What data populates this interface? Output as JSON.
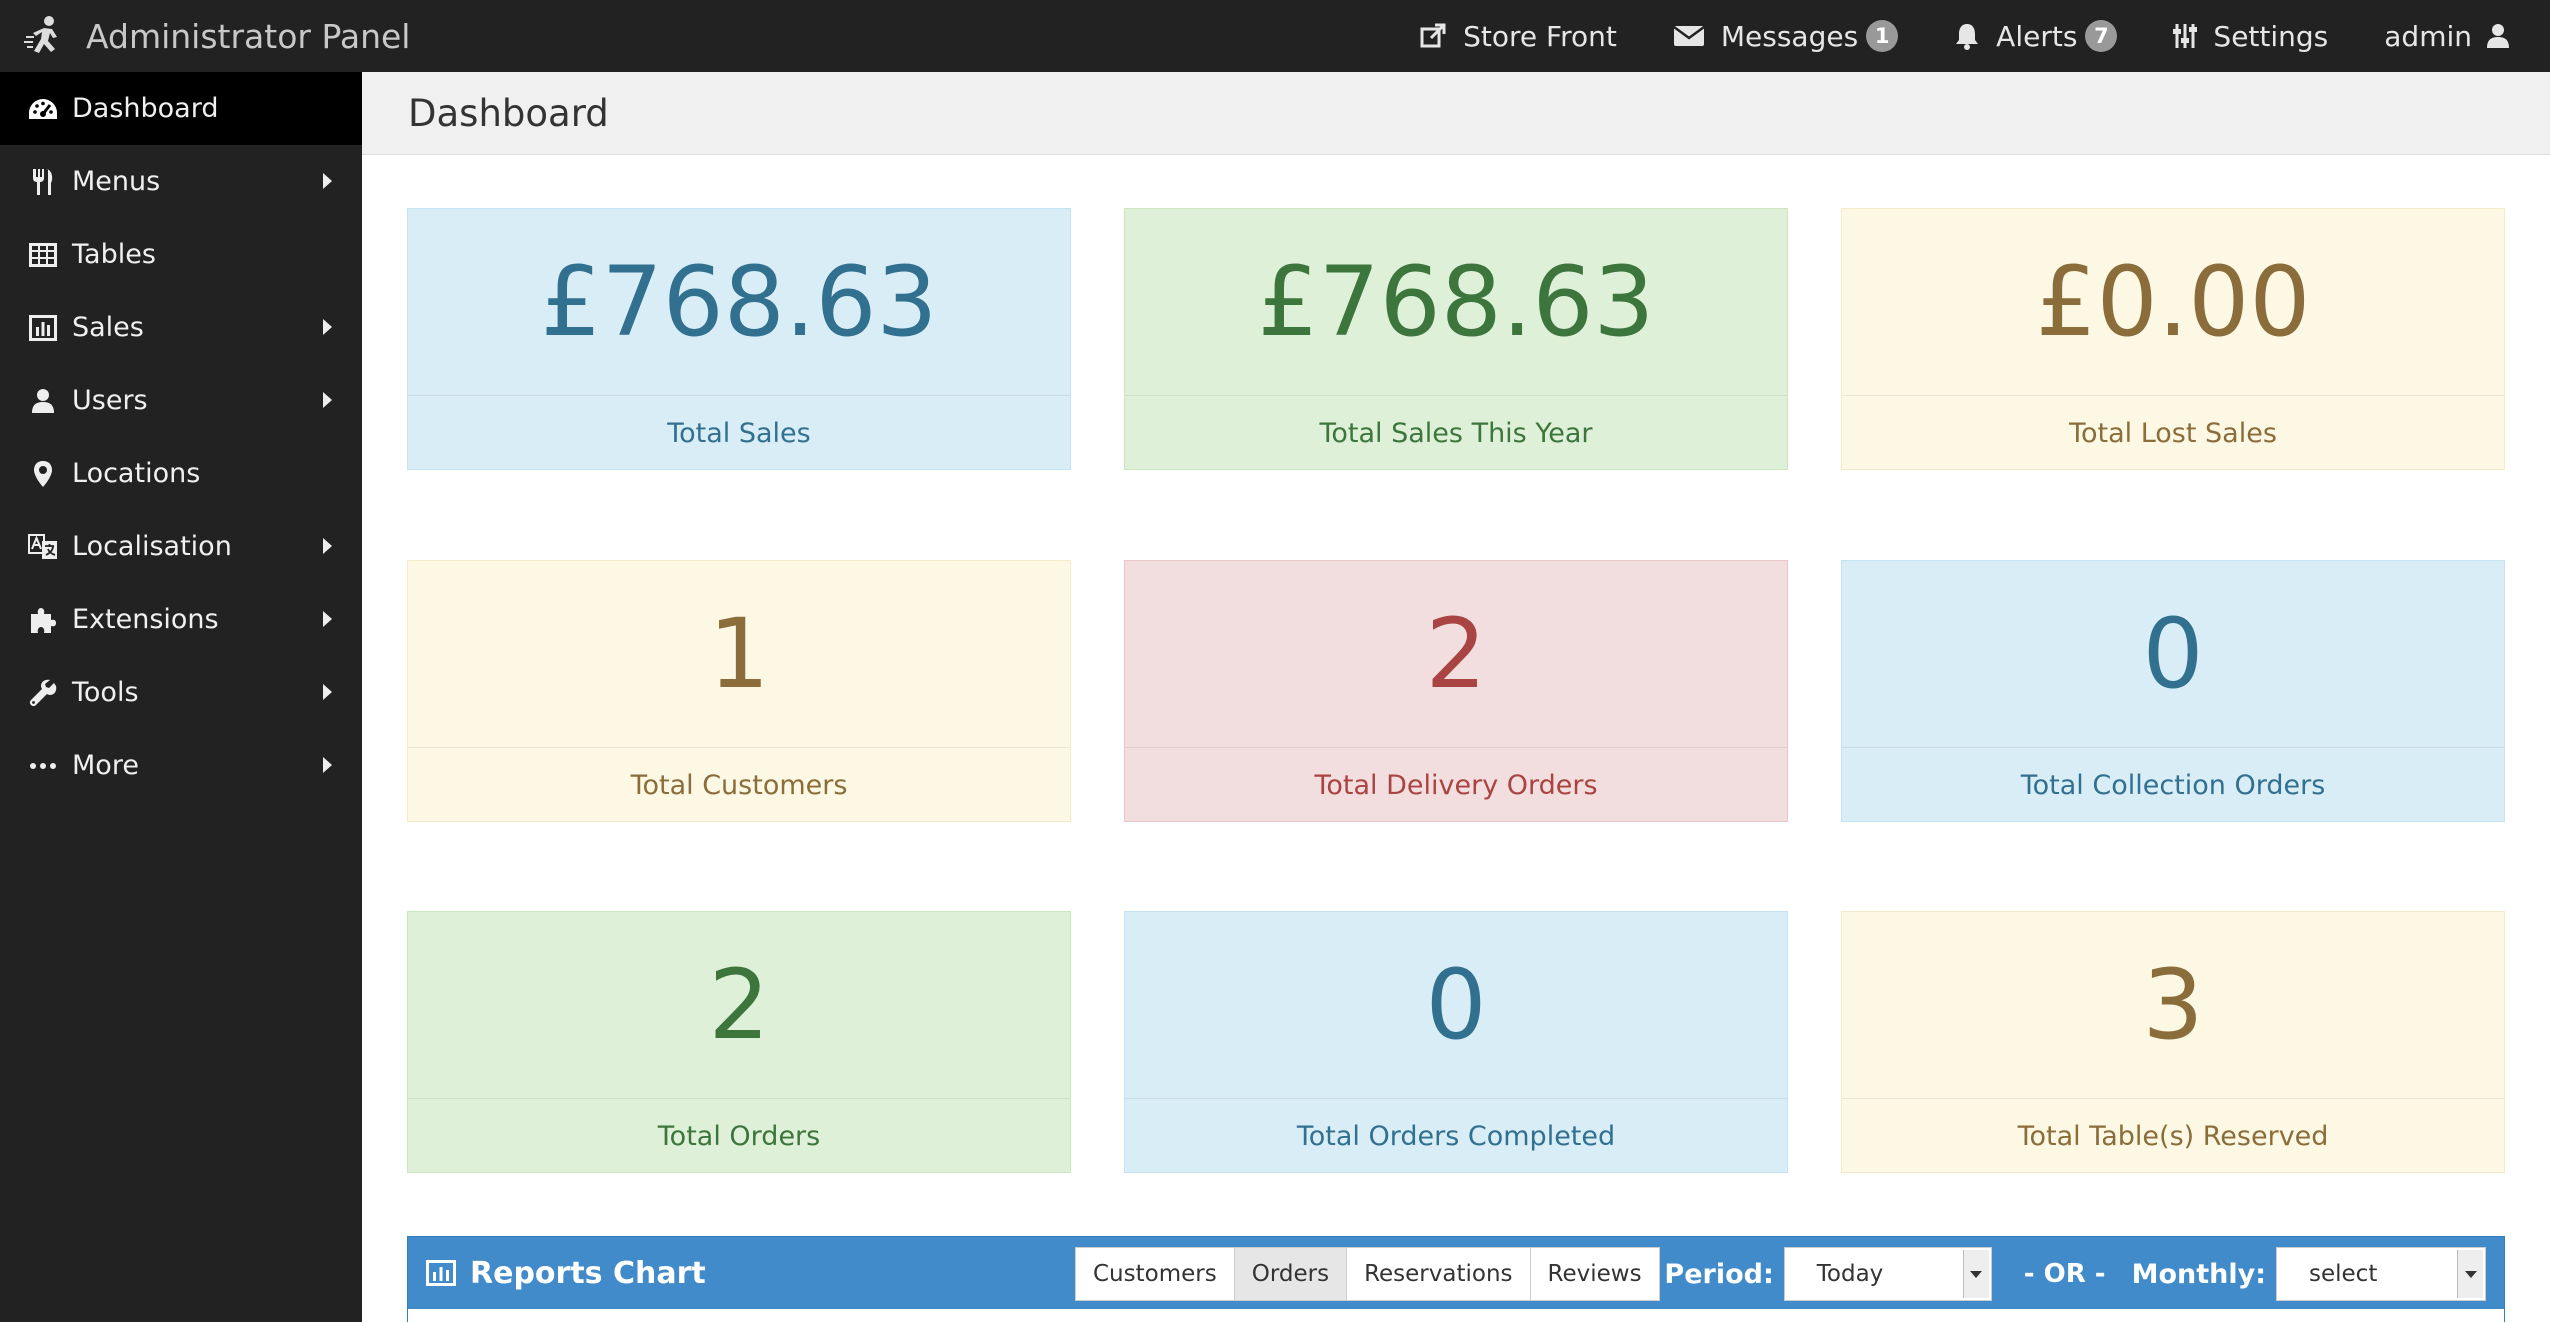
{
  "header": {
    "brand": "Administrator Panel",
    "nav": [
      {
        "label": "Store Front",
        "icon": "external-link-icon",
        "badge": null
      },
      {
        "label": "Messages",
        "icon": "envelope-icon",
        "badge": "1"
      },
      {
        "label": "Alerts",
        "icon": "bell-icon",
        "badge": "7"
      },
      {
        "label": "Settings",
        "icon": "sliders-icon",
        "badge": null
      },
      {
        "label": "admin",
        "icon": "user-icon",
        "badge": null
      }
    ]
  },
  "sidebar": {
    "items": [
      {
        "label": "Dashboard",
        "icon": "dashboard-icon",
        "active": true,
        "has_submenu": false
      },
      {
        "label": "Menus",
        "icon": "cutlery-icon",
        "active": false,
        "has_submenu": true
      },
      {
        "label": "Tables",
        "icon": "table-icon",
        "active": false,
        "has_submenu": false
      },
      {
        "label": "Sales",
        "icon": "bar-chart-icon",
        "active": false,
        "has_submenu": true
      },
      {
        "label": "Users",
        "icon": "user-icon",
        "active": false,
        "has_submenu": true
      },
      {
        "label": "Locations",
        "icon": "map-marker-icon",
        "active": false,
        "has_submenu": false
      },
      {
        "label": "Localisation",
        "icon": "translate-icon",
        "active": false,
        "has_submenu": true
      },
      {
        "label": "Extensions",
        "icon": "puzzle-icon",
        "active": false,
        "has_submenu": true
      },
      {
        "label": "Tools",
        "icon": "wrench-icon",
        "active": false,
        "has_submenu": true
      },
      {
        "label": "More",
        "icon": "ellipsis-icon",
        "active": false,
        "has_submenu": true
      }
    ]
  },
  "page": {
    "title": "Dashboard"
  },
  "stats": [
    {
      "value": "£768.63",
      "label": "Total Sales",
      "color": "blue"
    },
    {
      "value": "£768.63",
      "label": "Total Sales This Year",
      "color": "green"
    },
    {
      "value": "£0.00",
      "label": "Total Lost Sales",
      "color": "yellow"
    },
    {
      "value": "1",
      "label": "Total Customers",
      "color": "yellow"
    },
    {
      "value": "2",
      "label": "Total Delivery Orders",
      "color": "red"
    },
    {
      "value": "0",
      "label": "Total Collection Orders",
      "color": "blue"
    },
    {
      "value": "2",
      "label": "Total Orders",
      "color": "green"
    },
    {
      "value": "0",
      "label": "Total Orders Completed",
      "color": "blue"
    },
    {
      "value": "3",
      "label": "Total Table(s) Reserved",
      "color": "yellow"
    }
  ],
  "reports": {
    "title": "Reports Chart",
    "tabs": [
      "Customers",
      "Orders",
      "Reservations",
      "Reviews"
    ],
    "active_tab": "Orders",
    "period_label": "Period:",
    "period_value": "Today",
    "or_label": "- OR -",
    "monthly_label": "Monthly:",
    "monthly_value": "select"
  },
  "colors": {
    "navbar": "#222222",
    "sidebar_active": "#000000",
    "reports_header": "#428bca",
    "tile_blue": "#d9edf7",
    "tile_green": "#dff0d8",
    "tile_yellow": "#fcf8e3",
    "tile_red": "#f2dede"
  }
}
